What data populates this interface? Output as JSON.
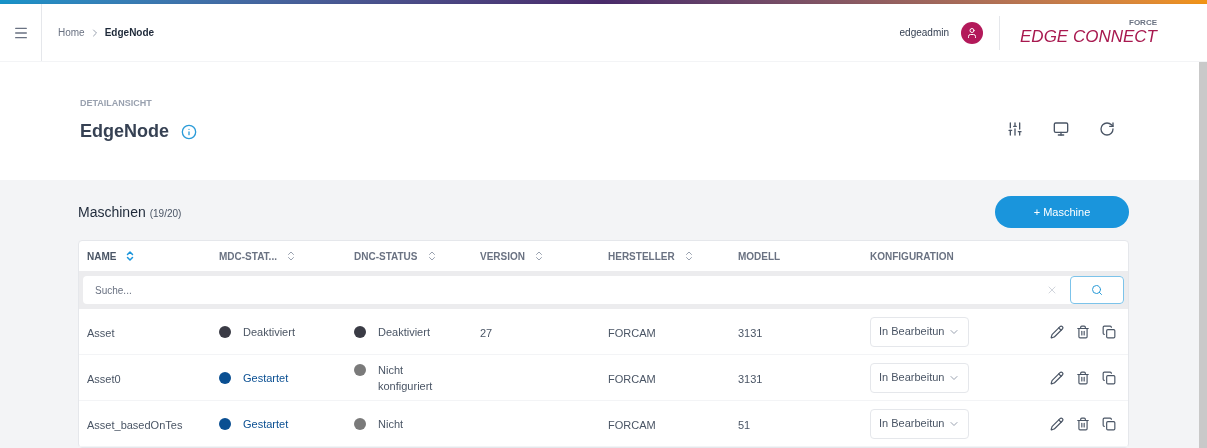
{
  "header": {
    "breadcrumb": [
      "Home",
      "EdgeNode"
    ],
    "user": "edgeadmin",
    "logo": {
      "main": "EDGE CONNECT",
      "super": "FORCE"
    }
  },
  "detail": {
    "overline": "DETAILANSICHT",
    "title": "EdgeNode"
  },
  "machines": {
    "title": "Maschinen",
    "count": "(19/20)",
    "add_button": "+ Maschine",
    "columns": [
      {
        "label": "NAME",
        "sortable": true,
        "selected": true
      },
      {
        "label": "MDC-STAT...",
        "sortable": true,
        "selected": false
      },
      {
        "label": "DNC-STATUS",
        "sortable": true,
        "selected": false
      },
      {
        "label": "VERSION",
        "sortable": true,
        "selected": false
      },
      {
        "label": "HERSTELLER",
        "sortable": true,
        "selected": false
      },
      {
        "label": "MODELL",
        "sortable": false,
        "selected": false
      },
      {
        "label": "KONFIGURATION",
        "sortable": false,
        "selected": false
      }
    ],
    "search": {
      "placeholder": "Suche..."
    },
    "rows": [
      {
        "name": "Asset",
        "mdc": {
          "text": "Deaktiviert",
          "color": "#3a3b45"
        },
        "dnc": {
          "text": "Deaktiviert",
          "color": "#3a3b45"
        },
        "version": "27",
        "hersteller": "FORCAM",
        "modell": "3131",
        "konfiguration": "In Bearbeitun"
      },
      {
        "name": "Asset0",
        "mdc": {
          "text": "Gestartet",
          "color": "#0a4f92"
        },
        "dnc": {
          "text": "Nicht konfiguriert",
          "color": "#7a7a7a"
        },
        "hersteller": "FORCAM",
        "modell": "3131",
        "konfiguration": "In Bearbeitun"
      },
      {
        "name": "Asset_basedOnTes",
        "mdc": {
          "text": "Gestartet",
          "color": "#0a4f92"
        },
        "dnc": {
          "text": "Nicht",
          "color": "#7a7a7a"
        },
        "hersteller": "FORCAM",
        "modell": "51",
        "konfiguration": "In Bearbeitun"
      }
    ]
  }
}
